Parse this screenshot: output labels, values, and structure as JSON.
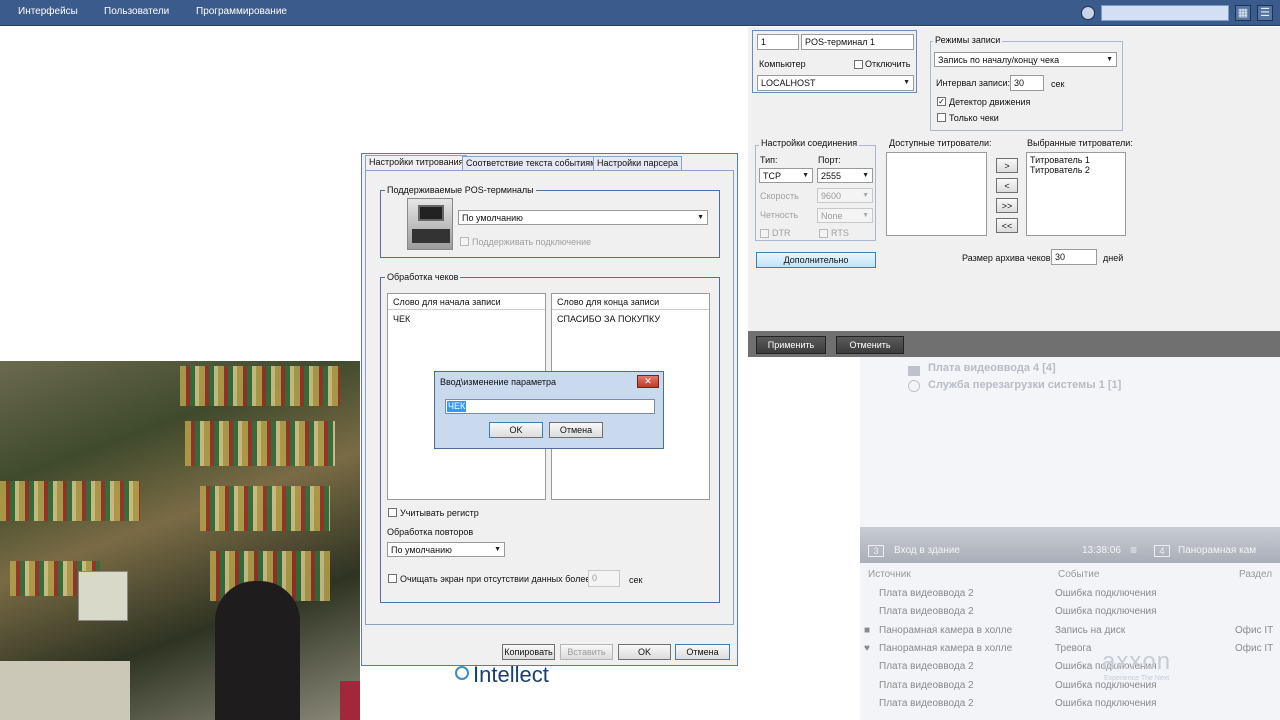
{
  "menu": [
    "Интерфейсы",
    "Пользователи",
    "Программирование"
  ],
  "device": {
    "id": "1",
    "name": "POS-терминал 1",
    "computer_label": "Компьютер",
    "disable_label": "Отключить",
    "computer_value": "LOCALHOST"
  },
  "record": {
    "group_title": "Режимы записи",
    "mode": "Запись по началу/концу чека",
    "interval_label": "Интервал записи:",
    "interval_value": "30",
    "interval_unit": "сек",
    "motion_label": "Детектор движения",
    "motion_checked": true,
    "only_checks_label": "Только чеки",
    "only_checks_checked": false
  },
  "connection": {
    "group_title": "Настройки соединения",
    "type_label": "Тип:",
    "type_value": "TCP",
    "port_label": "Порт:",
    "port_value": "2555",
    "speed_label": "Скорость",
    "speed_value": "9600",
    "parity_label": "Четность",
    "parity_value": "None",
    "dtr": "DTR",
    "rts": "RTS",
    "advanced_button": "Дополнительно"
  },
  "titlers": {
    "available_label": "Доступные титрователи:",
    "selected_label": "Выбранные титрователи:",
    "selected": [
      "Титрователь 1",
      "Титрователь 2"
    ],
    "move_buttons": [
      ">",
      "<",
      ">>",
      "<<"
    ]
  },
  "archive": {
    "label": "Размер архива чеков:",
    "value": "30",
    "unit": "дней"
  },
  "panel_buttons": {
    "apply": "Применить",
    "cancel": "Отменить"
  },
  "tree": {
    "item1": "Плата видеоввода 4 [4]",
    "item2": "Служба перезагрузки системы 1 [1]"
  },
  "dialog": {
    "tabs": [
      "Настройки титрования",
      "Соответствие текста событиям",
      "Настройки парсера"
    ],
    "pos_group": "Поддерживаемые POS-терминалы",
    "pos_type": "По умолчанию",
    "support_connection": "Поддерживать подключение",
    "checks_group": "Обработка чеков",
    "start_word_header": "Слово для начала записи",
    "end_word_header": "Слово для конца записи",
    "start_word": "ЧЕК",
    "end_word": "СПАСИБО ЗА ПОКУПКУ",
    "case_label": "Учитывать регистр",
    "repeat_label": "Обработка повторов",
    "repeat_value": "По умолчанию",
    "clear_label": "Очищать экран при отсутствии данных более",
    "clear_value": "0",
    "clear_unit": "сек",
    "buttons": {
      "copy": "Копировать",
      "paste": "Вставить",
      "ok": "OK",
      "cancel": "Отмена"
    }
  },
  "popup": {
    "title": "Ввод\\изменение параметра",
    "value": "ЧЕК",
    "ok": "OK",
    "cancel": "Отмена"
  },
  "cameras": [
    {
      "num": "3",
      "name": "Вход в здание",
      "time": "13:38:06"
    },
    {
      "num": "4",
      "name": "Панорамная кам"
    }
  ],
  "events": {
    "headers": [
      "Источник",
      "Событие",
      "Раздел"
    ],
    "rows": [
      {
        "source": "Плата видеоввода 2",
        "event": "Ошибка подключения",
        "section": ""
      },
      {
        "source": "Плата видеоввода 2",
        "event": "Ошибка подключения",
        "section": ""
      },
      {
        "source": "Панорамная камера в холле",
        "event": "Запись на диск",
        "section": "Офис IT"
      },
      {
        "source": "Панорамная камера в холле",
        "event": "Тревога",
        "section": "Офис IT"
      },
      {
        "source": "Плата видеоввода 2",
        "event": "Ошибка подключения",
        "section": ""
      },
      {
        "source": "Плата видеоввода 2",
        "event": "Ошибка подключения",
        "section": ""
      },
      {
        "source": "Плата видеоввода 2",
        "event": "Ошибка подключения",
        "section": ""
      }
    ]
  },
  "brand": {
    "intellect": "Intellect",
    "ect_fragment": "ect",
    "axxon": "axxon",
    "axxon_tag": "Experience The Next"
  },
  "colors": {
    "topbar": "#3a5b8c",
    "dialog_border": "#5b7bb0",
    "highlight": "#3399ff"
  }
}
